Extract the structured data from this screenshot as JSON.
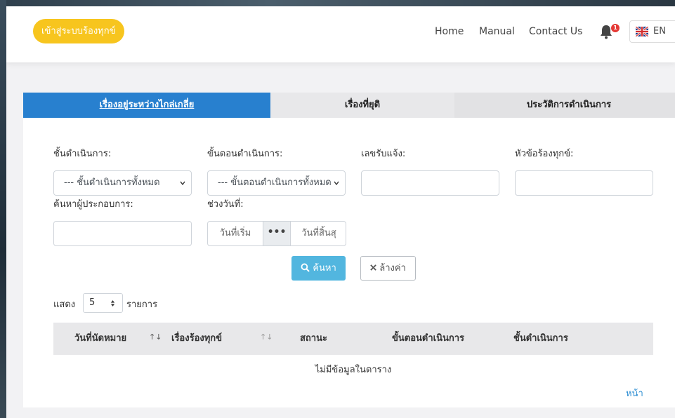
{
  "navbar": {
    "brand_button": "เข้าสู่ระบบร้องทุกข์",
    "links": [
      "Home",
      "Manual",
      "Contact Us"
    ],
    "notification_count": "1",
    "language": "EN"
  },
  "tabs": [
    {
      "label": "เรื่องอยู่ระหว่างไกล่เกลี่ย",
      "active": true
    },
    {
      "label": "เรื่องที่ยุติ",
      "active": false
    },
    {
      "label": "ประวัติการดำเนินการ",
      "active": false
    }
  ],
  "filters": {
    "stage_label": "ชั้นดำเนินการ:",
    "stage_value": "--- ชั้นดำเนินการทั้งหมด",
    "step_label": "ขั้นตอนดำเนินการ:",
    "step_value": "--- ขั้นตอนดำเนินการทั้งหมด",
    "ref_label": "เลขรับแจ้ง:",
    "ref_value": "",
    "topic_label": "หัวข้อร้องทุกข์:",
    "topic_value": "",
    "operator_label": "ค้นหาผู้ประกอบการ:",
    "operator_value": "",
    "date_label": "ช่วงวันที่:",
    "date_start": "วันที่เริ่ม",
    "date_sep": "•••",
    "date_end": "วันที่สิ้นสุ"
  },
  "actions": {
    "search": "ค้นหา",
    "clear": "ล้างค่า"
  },
  "table": {
    "show_prefix": "แสดง",
    "page_size": "5",
    "show_suffix": "รายการ",
    "columns": [
      "วันที่นัดหมาย",
      "เรื่องร้องทุกข์",
      "สถานะ",
      "ขั้นตอนดำเนินการ",
      "ชั้นดำเนินการ"
    ],
    "empty_message": "ไม่มีข้อมูลในตาราง",
    "page_label": "หน้า"
  },
  "colors": {
    "brand": "#f7c51e",
    "tab_active": "#2880cf",
    "search_button": "#52b6df",
    "badge": "#e53935",
    "link": "#2f8fd3"
  }
}
